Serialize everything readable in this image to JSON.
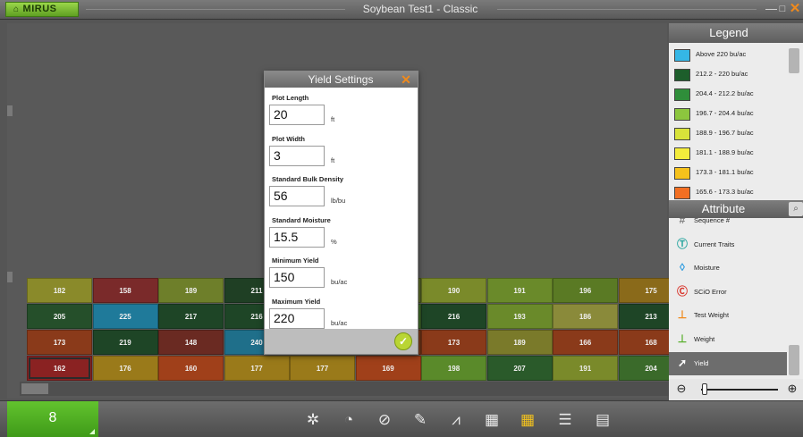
{
  "app": {
    "brand": "MIRUS",
    "window_title": "Soybean Test1 - Classic",
    "controls": {
      "minimize": "—",
      "maximize": "□",
      "close": "✕"
    }
  },
  "dialog": {
    "title": "Yield Settings",
    "close_glyph": "✕",
    "ok_glyph": "✓",
    "fields": [
      {
        "label": "Plot Length",
        "value": "20",
        "unit": "ft"
      },
      {
        "label": "Plot Width",
        "value": "3",
        "unit": "ft"
      },
      {
        "label": "Standard Bulk Density",
        "value": "56",
        "unit": "lb/bu"
      },
      {
        "label": "Standard Moisture",
        "value": "15.5",
        "unit": "%"
      },
      {
        "label": "Minimum Yield",
        "value": "150",
        "unit": "bu/ac"
      },
      {
        "label": "Maximum Yield",
        "value": "220",
        "unit": "bu/ac"
      }
    ]
  },
  "legend": {
    "title": "Legend",
    "items": [
      {
        "label": "Above 220 bu/ac",
        "color": "#35b7e6"
      },
      {
        "label": "212.2 - 220 bu/ac",
        "color": "#1d5e2b"
      },
      {
        "label": "204.4 - 212.2 bu/ac",
        "color": "#2f8e3a"
      },
      {
        "label": "196.7 - 204.4 bu/ac",
        "color": "#8cc63e"
      },
      {
        "label": "188.9 - 196.7 bu/ac",
        "color": "#d8e33a"
      },
      {
        "label": "181.1 - 188.9 bu/ac",
        "color": "#f4ec3c"
      },
      {
        "label": "173.3 - 181.1 bu/ac",
        "color": "#f6c21c"
      },
      {
        "label": "165.6 - 173.3 bu/ac",
        "color": "#f26f22"
      }
    ]
  },
  "attributes": {
    "title": "Attribute",
    "items": [
      {
        "label": "Sequence #",
        "icon": "sequence-icon",
        "glyph": "#",
        "color": "#7a7a7a"
      },
      {
        "label": "Current Traits",
        "icon": "traits-icon",
        "glyph": "Ⓣ",
        "color": "#2aa6a0"
      },
      {
        "label": "Moisture",
        "icon": "droplet-icon",
        "glyph": "◊",
        "color": "#2c9be0"
      },
      {
        "label": "SCiO Error",
        "icon": "scio-icon",
        "glyph": "Ⓒ",
        "color": "#d8342a"
      },
      {
        "label": "Test Weight",
        "icon": "test-weight-icon",
        "glyph": "⊥",
        "color": "#f08a1c"
      },
      {
        "label": "Weight",
        "icon": "weight-icon",
        "glyph": "⊥",
        "color": "#5bb030"
      },
      {
        "label": "Yield",
        "icon": "yield-icon",
        "glyph": "➚",
        "color": "#ffffff"
      }
    ],
    "active_index": 6
  },
  "plots": {
    "rows": [
      [
        {
          "value": "182",
          "color": "#8a8a2a"
        },
        {
          "value": "158",
          "color": "#7a2a2a"
        },
        {
          "value": "189",
          "color": "#6e7f2a"
        },
        {
          "value": "211",
          "color": "#1f3f24"
        },
        {
          "value": "",
          "color": "#4a6a2a"
        },
        {
          "value": "",
          "color": "#5a6a2a"
        },
        {
          "value": "190",
          "color": "#7a8a2a"
        },
        {
          "value": "191",
          "color": "#6a8a2a"
        },
        {
          "value": "196",
          "color": "#5a7a24"
        },
        {
          "value": "175",
          "color": "#8a6a1a"
        }
      ],
      [
        {
          "value": "205",
          "color": "#254f2a"
        },
        {
          "value": "225",
          "color": "#1f7a9a"
        },
        {
          "value": "217",
          "color": "#1e4526"
        },
        {
          "value": "216",
          "color": "#1e4526"
        },
        {
          "value": "",
          "color": "#2f5f2a"
        },
        {
          "value": "",
          "color": "#3f6a2a"
        },
        {
          "value": "216",
          "color": "#1e4526"
        },
        {
          "value": "193",
          "color": "#6a8a2a"
        },
        {
          "value": "186",
          "color": "#8a8a3a"
        },
        {
          "value": "213",
          "color": "#1e4526"
        }
      ],
      [
        {
          "value": "173",
          "color": "#8a3a1a"
        },
        {
          "value": "219",
          "color": "#1e4526"
        },
        {
          "value": "148",
          "color": "#6a2a22"
        },
        {
          "value": "240",
          "color": "#1f6f8a"
        },
        {
          "value": "",
          "color": "#7a3a2a"
        },
        {
          "value": "",
          "color": "#7a3a1a"
        },
        {
          "value": "173",
          "color": "#8a3a1a"
        },
        {
          "value": "189",
          "color": "#7a7a2a"
        },
        {
          "value": "166",
          "color": "#8a3a1a"
        },
        {
          "value": "168",
          "color": "#8a3a1a"
        }
      ],
      [
        {
          "value": "162",
          "color": "#8a2222"
        },
        {
          "value": "176",
          "color": "#9a7a1a"
        },
        {
          "value": "160",
          "color": "#a0401a"
        },
        {
          "value": "177",
          "color": "#9a7a1a"
        },
        {
          "value": "177",
          "color": "#9a7a1a"
        },
        {
          "value": "169",
          "color": "#a0401a"
        },
        {
          "value": "198",
          "color": "#5a8a2a"
        },
        {
          "value": "207",
          "color": "#2a5a2a"
        },
        {
          "value": "191",
          "color": "#7a8a2a"
        },
        {
          "value": "204",
          "color": "#3a6a2a"
        }
      ]
    ],
    "selected": {
      "row": 3,
      "col": 0
    }
  },
  "toolbar": {
    "page_number": "8",
    "tools": [
      {
        "name": "settings-gear-icon",
        "glyph": "✲",
        "active": false
      },
      {
        "name": "timer-icon",
        "glyph": "◔",
        "active": false
      },
      {
        "name": "compass-icon",
        "glyph": "⊘",
        "active": false
      },
      {
        "name": "pencil-icon",
        "glyph": "✎",
        "active": false
      },
      {
        "name": "chart-icon",
        "glyph": "⩘",
        "active": false
      },
      {
        "name": "grid-large-icon",
        "glyph": "▦",
        "active": false
      },
      {
        "name": "heatmap-icon",
        "glyph": "▦",
        "active": true
      },
      {
        "name": "list-icon",
        "glyph": "☰",
        "active": false
      },
      {
        "name": "table-icon",
        "glyph": "▤",
        "active": false
      }
    ]
  },
  "zoom": {
    "out_glyph": "⊖",
    "in_glyph": "⊕",
    "level_fraction": 0.05
  }
}
